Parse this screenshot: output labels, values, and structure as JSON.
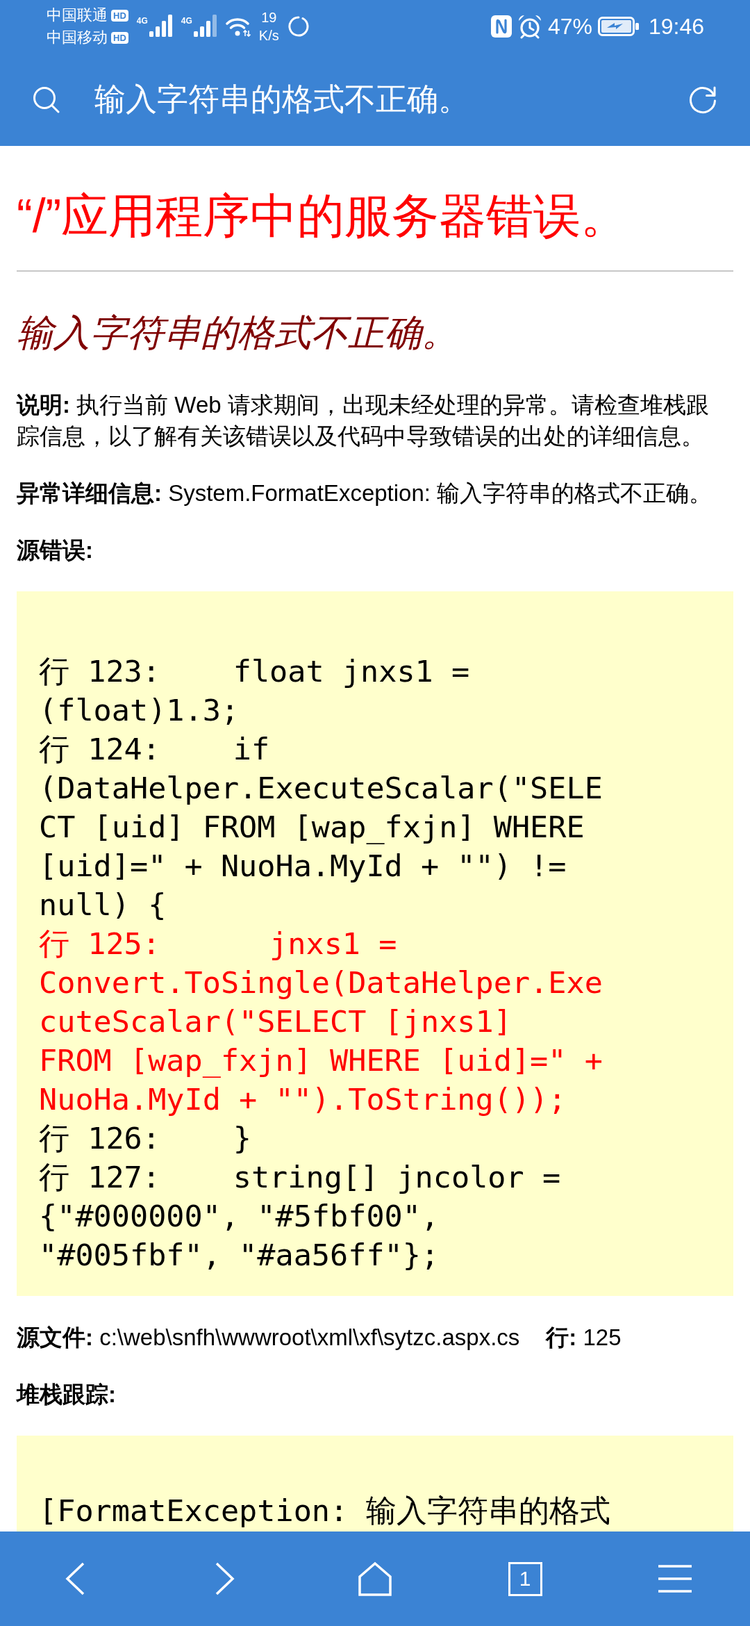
{
  "status_bar": {
    "carriers": [
      {
        "name": "中国联通",
        "badge": "HD"
      },
      {
        "name": "中国移动",
        "badge": "HD"
      }
    ],
    "networks": [
      {
        "type": "4G"
      },
      {
        "type": "4G"
      }
    ],
    "speed": {
      "value": "19",
      "unit": "K/s"
    },
    "battery": "47%",
    "time": "19:46"
  },
  "toolbar": {
    "title": "输入字符串的格式不正确。"
  },
  "page": {
    "heading": "“/”应用程序中的服务器错误。",
    "subheading": "输入字符串的格式不正确。",
    "sections": [
      {
        "kind": "paragraph",
        "text": "**说明:** 执行当前 Web 请求期间，出现未经处理的异常。请检查堆栈跟踪信息，以了解有关该错误以及代码中导致错误的出处的详细信息。"
      },
      {
        "kind": "paragraph",
        "text": "**异常详细信息:** System.FormatException: 输入字符串的格式不正确。"
      },
      {
        "kind": "label",
        "text": "源错误:"
      },
      {
        "kind": "code",
        "lines": [
          {
            "highlighted": false,
            "wrapped": [
              "行 123:    float jnxs1 =",
              "(float)1.3;"
            ]
          },
          {
            "highlighted": false,
            "wrapped": [
              "行 124:    if",
              "(DataHelper.ExecuteScalar(\"SELE",
              "CT [uid] FROM [wap_fxjn] WHERE",
              "[uid]=\" + NuoHa.MyId + \"\") !=",
              "null) {"
            ]
          },
          {
            "highlighted": true,
            "wrapped": [
              "行 125:      jnxs1 =",
              "Convert.ToSingle(DataHelper.Exe",
              "cuteScalar(\"SELECT [jnxs1]",
              "FROM [wap_fxjn] WHERE [uid]=\" +",
              "NuoHa.MyId + \"\").ToString());"
            ]
          },
          {
            "highlighted": false,
            "wrapped": [
              "行 126:    }"
            ]
          },
          {
            "highlighted": false,
            "wrapped": [
              "行 127:    string[] jncolor =",
              "{\"#000000\", \"#5fbf00\",",
              "\"#005fbf\", \"#aa56ff\"};"
            ]
          }
        ]
      },
      {
        "kind": "source",
        "parts": [
          "**源文件:** c:\\web\\snfh\\wwwroot\\xml\\xf\\sytzc.aspx.cs",
          "**行:** 125"
        ]
      },
      {
        "kind": "label",
        "text": "堆栈跟踪:"
      },
      {
        "kind": "code",
        "lines": [
          {
            "highlighted": false,
            "wrapped": [
              "[FormatException: 输入字符串的格式"
            ]
          }
        ]
      }
    ]
  },
  "bottom_nav": {
    "tab_count": "1"
  }
}
